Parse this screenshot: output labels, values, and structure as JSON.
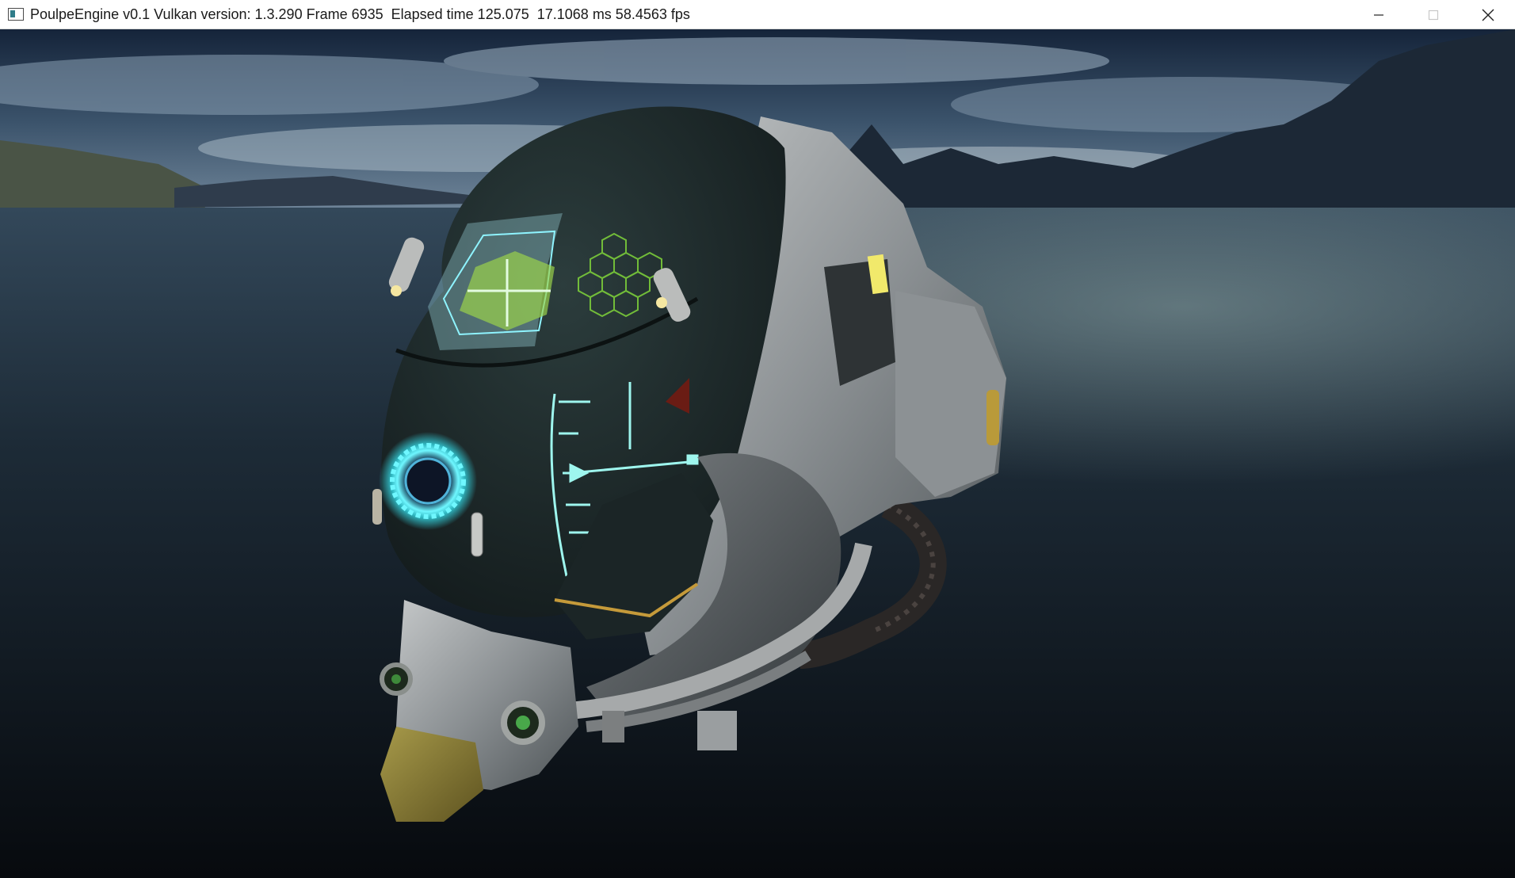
{
  "window": {
    "title": "PoulpeEngine v0.1 Vulkan version: 1.3.290 Frame 6935  Elapsed time 125.075  17.1068 ms 58.4563 fps",
    "app_icon": "app-window-icon",
    "controls": {
      "minimize_icon": "minimize-icon",
      "maximize_icon": "maximize-icon",
      "close_icon": "close-icon"
    }
  },
  "scene": {
    "description_icon": "rendered-3d-viewport",
    "colors": {
      "sky_top": "#1c2b3f",
      "sky_mid": "#6d869c",
      "water": "#1a2631",
      "helmet_metal": "#8f9497",
      "helmet_dark": "#1f2d2d",
      "hud_cyan": "#5ff2e6",
      "hud_green": "#8fe04a"
    }
  }
}
